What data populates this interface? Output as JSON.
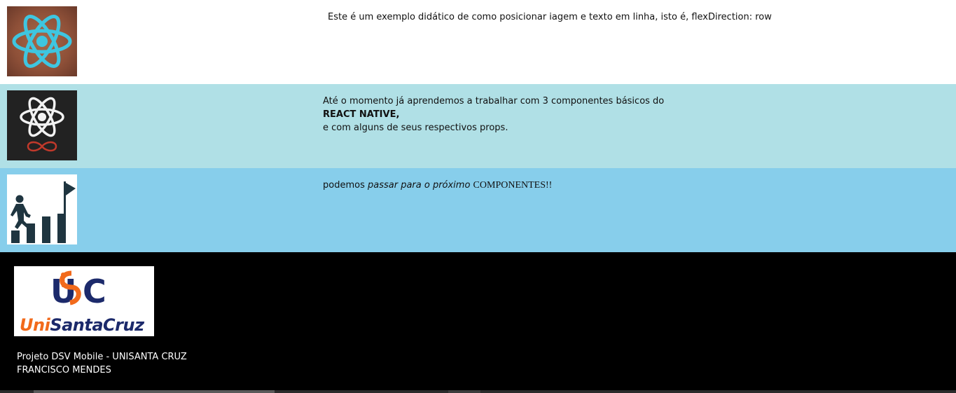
{
  "rows": [
    {
      "image_icon": "react-atom-logo-icon",
      "text": "Este é um exemplo didático de como posicionar iagem e texto em linha, isto é, flexDirection: row",
      "background": "#ffffff"
    },
    {
      "image_icon": "react-native-logo-icon",
      "line1": "Até o momento já aprendemos a trabalhar com 3 componentes básicos do",
      "line2": "REACT NATIVE,",
      "line3": "e com alguns de seus respectivos props.",
      "background": "#b0e0e6"
    },
    {
      "image_icon": "steps-to-goal-icon",
      "part1": "podemos ",
      "part2": "passar para o próximo ",
      "part3": " COMPONENTES!!",
      "background": "#87ceeb"
    }
  ],
  "footer": {
    "logo_text": "UniSantaCruz",
    "logo_mark": "USC",
    "line1": "Projeto DSV Mobile - UNISANTA CRUZ",
    "line2": "FRANCISCO MENDES",
    "background": "#000000"
  },
  "colors": {
    "react_cyan": "#3ec6e0",
    "logo_blue": "#1c2a6b",
    "logo_orange": "#f26a1b"
  }
}
